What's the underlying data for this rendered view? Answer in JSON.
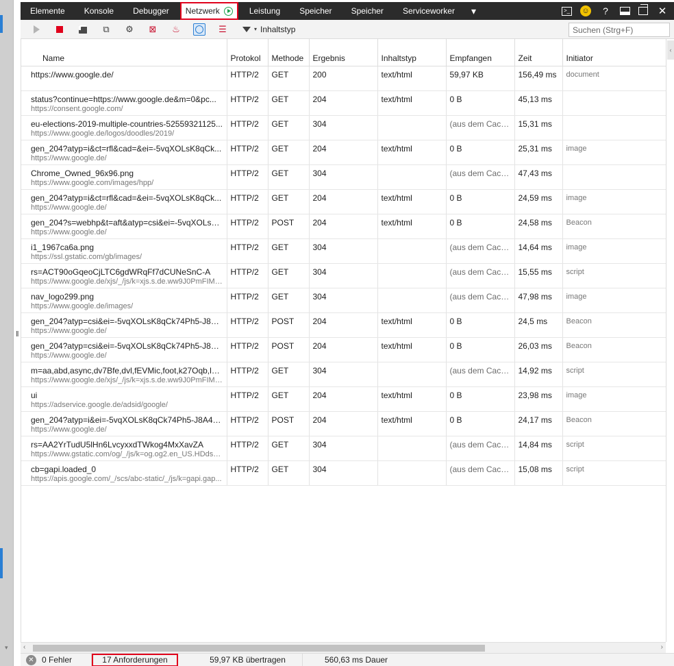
{
  "tabs": [
    {
      "label": "Elemente",
      "active": false
    },
    {
      "label": "Konsole",
      "active": false
    },
    {
      "label": "Debugger",
      "active": false
    },
    {
      "label": "Netzwerk",
      "active": true
    },
    {
      "label": "Leistung",
      "active": false
    },
    {
      "label": "Speicher",
      "active": false
    },
    {
      "label": "Speicher",
      "active": false
    },
    {
      "label": "Serviceworker",
      "active": false
    }
  ],
  "toolbar": {
    "filter_label": "Inhaltstyp",
    "search_placeholder": "Suchen (Strg+F)"
  },
  "columns": [
    "Name",
    "Protokol",
    "Methode",
    "Ergebnis",
    "Inhaltstyp",
    "Empfangen",
    "Zeit",
    "Initiator"
  ],
  "rows": [
    {
      "name": "https://www.google.de/",
      "url": "",
      "protocol": "HTTP/2",
      "method": "GET",
      "result": "200",
      "type": "text/html",
      "received": "59,97 KB",
      "time": "156,49 ms",
      "initiator": "document"
    },
    {
      "name": "status?continue=https://www.google.de&m=0&pc...",
      "url": "https://consent.google.com/",
      "protocol": "HTTP/2",
      "method": "GET",
      "result": "204",
      "type": "text/html",
      "received": "0 B",
      "time": "45,13 ms",
      "initiator": ""
    },
    {
      "name": "eu-elections-2019-multiple-countries-52559321125...",
      "url": "https://www.google.de/logos/doodles/2019/",
      "protocol": "HTTP/2",
      "method": "GET",
      "result": "304",
      "type": "",
      "received": "(aus dem Cache)",
      "time": "15,31 ms",
      "initiator": ""
    },
    {
      "name": "gen_204?atyp=i&ct=rfl&cad=&ei=-5vqXOLsK8qCk...",
      "url": "https://www.google.de/",
      "protocol": "HTTP/2",
      "method": "GET",
      "result": "204",
      "type": "text/html",
      "received": "0 B",
      "time": "25,31 ms",
      "initiator": "image"
    },
    {
      "name": "Chrome_Owned_96x96.png",
      "url": "https://www.google.com/images/hpp/",
      "protocol": "HTTP/2",
      "method": "GET",
      "result": "304",
      "type": "",
      "received": "(aus dem Cache)",
      "time": "47,43 ms",
      "initiator": ""
    },
    {
      "name": "gen_204?atyp=i&ct=rfl&cad=&ei=-5vqXOLsK8qCk...",
      "url": "https://www.google.de/",
      "protocol": "HTTP/2",
      "method": "GET",
      "result": "204",
      "type": "text/html",
      "received": "0 B",
      "time": "24,59 ms",
      "initiator": "image"
    },
    {
      "name": "gen_204?s=webhp&t=aft&atyp=csi&ei=-5vqXOLsK...",
      "url": "https://www.google.de/",
      "protocol": "HTTP/2",
      "method": "POST",
      "result": "204",
      "type": "text/html",
      "received": "0 B",
      "time": "24,58 ms",
      "initiator": "Beacon"
    },
    {
      "name": "i1_1967ca6a.png",
      "url": "https://ssl.gstatic.com/gb/images/",
      "protocol": "HTTP/2",
      "method": "GET",
      "result": "304",
      "type": "",
      "received": "(aus dem Cache)",
      "time": "14,64 ms",
      "initiator": "image"
    },
    {
      "name": "rs=ACT90oGqeoCjLTC6gdWRqFf7dCUNeSnC-A",
      "url": "https://www.google.de/xjs/_/js/k=xjs.s.de.ww9J0PmFIM0...",
      "protocol": "HTTP/2",
      "method": "GET",
      "result": "304",
      "type": "",
      "received": "(aus dem Cache)",
      "time": "15,55 ms",
      "initiator": "script"
    },
    {
      "name": "nav_logo299.png",
      "url": "https://www.google.de/images/",
      "protocol": "HTTP/2",
      "method": "GET",
      "result": "304",
      "type": "",
      "received": "(aus dem Cache)",
      "time": "47,98 ms",
      "initiator": "image"
    },
    {
      "name": "gen_204?atyp=csi&ei=-5vqXOLsK8qCk74Ph5-J8A4...",
      "url": "https://www.google.de/",
      "protocol": "HTTP/2",
      "method": "POST",
      "result": "204",
      "type": "text/html",
      "received": "0 B",
      "time": "24,5 ms",
      "initiator": "Beacon"
    },
    {
      "name": "gen_204?atyp=csi&ei=-5vqXOLsK8qCk74Ph5-J8A4...",
      "url": "https://www.google.de/",
      "protocol": "HTTP/2",
      "method": "POST",
      "result": "204",
      "type": "text/html",
      "received": "0 B",
      "time": "26,03 ms",
      "initiator": "Beacon"
    },
    {
      "name": "m=aa,abd,async,dv7Bfe,dvl,fEVMic,foot,k27Oqb,lu,...",
      "url": "https://www.google.de/xjs/_/js/k=xjs.s.de.ww9J0PmFIM0...",
      "protocol": "HTTP/2",
      "method": "GET",
      "result": "304",
      "type": "",
      "received": "(aus dem Cache)",
      "time": "14,92 ms",
      "initiator": "script"
    },
    {
      "name": "ui",
      "url": "https://adservice.google.de/adsid/google/",
      "protocol": "HTTP/2",
      "method": "GET",
      "result": "204",
      "type": "text/html",
      "received": "0 B",
      "time": "23,98 ms",
      "initiator": "image"
    },
    {
      "name": "gen_204?atyp=i&ei=-5vqXOLsK8qCk74Ph5-J8A4&v...",
      "url": "https://www.google.de/",
      "protocol": "HTTP/2",
      "method": "POST",
      "result": "204",
      "type": "text/html",
      "received": "0 B",
      "time": "24,17 ms",
      "initiator": "Beacon"
    },
    {
      "name": "rs=AA2YrTudU5lHn6LvcyxxdTWkog4MxXavZA",
      "url": "https://www.gstatic.com/og/_/js/k=og.og2.en_US.HDdsd...",
      "protocol": "HTTP/2",
      "method": "GET",
      "result": "304",
      "type": "",
      "received": "(aus dem Cache)",
      "time": "14,84 ms",
      "initiator": "script"
    },
    {
      "name": "cb=gapi.loaded_0",
      "url": "https://apis.google.com/_/scs/abc-static/_/js/k=gapi.gap...",
      "protocol": "HTTP/2",
      "method": "GET",
      "result": "304",
      "type": "",
      "received": "(aus dem Cache)",
      "time": "15,08 ms",
      "initiator": "script"
    }
  ],
  "status": {
    "errors": "0 Fehler",
    "requests": "17 Anforderungen",
    "transferred": "59,97 KB übertragen",
    "duration": "560,63 ms Dauer"
  },
  "icons": {
    "more_tabs": "chevron-down-icon",
    "console_toggle": "console-icon",
    "feedback": "smiley-icon",
    "help": "help-icon",
    "dock": "dock-icon",
    "undock": "undock-icon",
    "close": "close-icon"
  },
  "colors": {
    "highlight": "#e0001b",
    "tabbar_bg": "#2b2b2b",
    "active_play": "#1aa34a",
    "stop": "#e0001b"
  }
}
